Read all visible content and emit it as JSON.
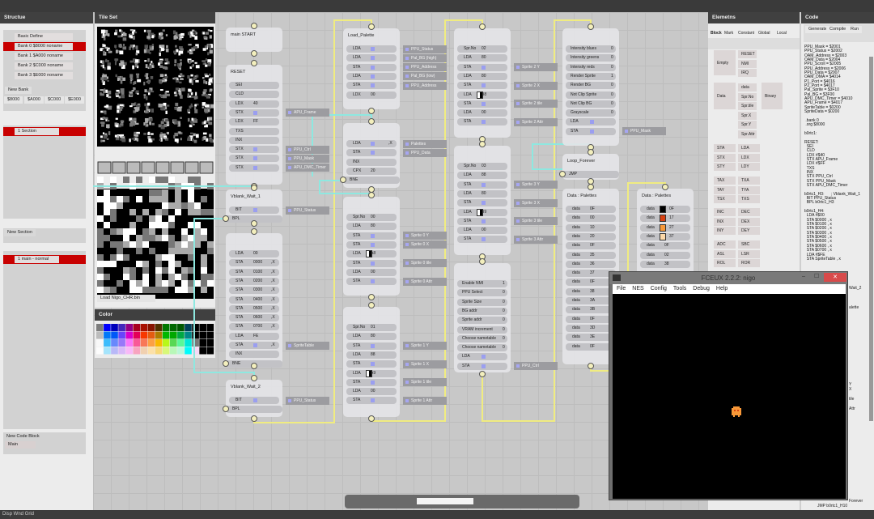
{
  "status_bar": "Disp Wnd Grid",
  "structure": {
    "title": "Structue",
    "banks": [
      "Basic Define",
      "Bank 0 $8000 noname",
      "Bank 1 $A000 noname",
      "Bank 2 $C000 noname",
      "Bank 3 $E000 noname"
    ],
    "selected_bank": 1,
    "new_bank": "New Bank",
    "bank_addrs": [
      "$8000",
      "$A000",
      "$C000",
      "$E000"
    ],
    "section": "1 Section",
    "new_section": "New Section",
    "block": "1 main - normal",
    "new_code_block": "New Code Block",
    "code_block_name": "Main"
  },
  "tileset": {
    "title": "Tile Set",
    "load_button": "Load Nigo_CHR.bin"
  },
  "color": {
    "title": "Color"
  },
  "elements": {
    "title": "Elemetns",
    "tabs": [
      "Block",
      "Mark",
      "Constant",
      "Global",
      "Local"
    ],
    "empty": "Empty",
    "vectors": [
      "RESET",
      "NMI",
      "IRQ"
    ],
    "data": "Data",
    "data_items": [
      "data",
      "Spr.No",
      "Spr.tile",
      "Spr.X",
      "Spr.Y",
      "Spr.Attr"
    ],
    "binary": "Binary",
    "ops": [
      [
        "STA",
        "LDA"
      ],
      [
        "STX",
        "LDX"
      ],
      [
        "STY",
        "LDY"
      ],
      [
        "TAX",
        "TXA"
      ],
      [
        "TAY",
        "TYA"
      ],
      [
        "TSX",
        "TXS"
      ],
      [
        "INC",
        "DEC"
      ],
      [
        "INX",
        "DEX"
      ],
      [
        "INY",
        "DEY"
      ],
      [
        "ADC",
        "SBC"
      ],
      [
        "ASL",
        "LSR"
      ],
      [
        "ROL",
        "ROR"
      ]
    ]
  },
  "code": {
    "title": "Code",
    "buttons": [
      "Generate",
      "Compile",
      "Run"
    ],
    "text": "PPU_Mask = $2001\nPPU_Status = $2002\nOAM_Address = $2003\nOAM_Data = $2004\nPPU_Scroll = $2005\nPPU_Address = $2006\nPPU_Data = $2007\nOAM_DMA = $4014\nP1_Port = $4016\nP2_Port = $4017\nPal_Sprite = $3F10\nPal_BG = $3F00\nAPU_DMC_Timer = $4010\nAPU_Frame = $4017\nSpriteTable = $0200\nSpriteData = $0200\n\n .bank 0\n .org $8000\n\nb0rtc1:\n\nRESET:\n  SEI\n  CLD\n  LDX #$40\n  STX APU_Frame\n  LDX #$FF\n  TXS\n  INX\n  STX PPU_Ctrl\n  STX PPU_Mask\n  STX APU_DMC_Timer\n\nb0rtc1_H3:      ; Vblank_Wait_1\n  BIT PPU_Status\n  BPL b0rtc1_H3\n\nb0rtc1_H4:\n  LDA #$00\n  STA $0000 , x\n  STA $0100 , x\n  STA $0200 , x\n  STA $0300 , x\n  STA $0400 , x\n  STA $0500 , x\n  STA $0600 , x\n  STA $0700 , x\n  LDA #$FE\n  STA SpriteTable , x",
    "fragments": [
      "Wait_2",
      "alette",
      "Y",
      "X",
      "tile",
      "Attr",
      "Forever",
      "JMP b0rtc1_H10"
    ]
  },
  "nodes": [
    {
      "title": "main START",
      "rows": []
    },
    {
      "title": "RESET",
      "rows": [
        {
          "op": "SEI"
        },
        {
          "op": "CLD"
        },
        {
          "op": "LDX",
          "val": "40"
        },
        {
          "op": "STX",
          "ref": "APU_Frame"
        },
        {
          "op": "LDX",
          "val": "FF"
        },
        {
          "op": "TXS"
        },
        {
          "op": "INX"
        },
        {
          "op": "STX",
          "ref": "PPU_Ctrl"
        },
        {
          "op": "STX",
          "ref": "PPU_Mask"
        },
        {
          "op": "STX",
          "ref": "APU_DMC_Timer"
        }
      ]
    },
    {
      "title": "Vblank_Wait_1",
      "rows": [
        {
          "op": "BIT",
          "ref": "PPU_Status"
        },
        {
          "op": "BPL",
          "branch": true
        }
      ]
    },
    {
      "title": "",
      "rows": [
        {
          "op": "LDA",
          "val": "00"
        },
        {
          "op": "STA",
          "val": "0000",
          "x": ",X"
        },
        {
          "op": "STA",
          "val": "0100",
          "x": ",X"
        },
        {
          "op": "STA",
          "val": "0200",
          "x": ",X"
        },
        {
          "op": "STA",
          "val": "0300",
          "x": ",X"
        },
        {
          "op": "STA",
          "val": "0400",
          "x": ",X"
        },
        {
          "op": "STA",
          "val": "0500",
          "x": ",X"
        },
        {
          "op": "STA",
          "val": "0600",
          "x": ",X"
        },
        {
          "op": "STA",
          "val": "0700",
          "x": ",X"
        },
        {
          "op": "LDA",
          "val": "FE"
        },
        {
          "op": "STA",
          "ref": "SpriteTable",
          "x": ",X"
        },
        {
          "op": "INX"
        },
        {
          "op": "BNE",
          "branch": true
        }
      ]
    },
    {
      "title": "Vblank_Wait_2",
      "rows": [
        {
          "op": "BIT",
          "ref": "PPU_Status"
        },
        {
          "op": "BPL",
          "branch": true
        }
      ]
    },
    {
      "title": "Load_Palette",
      "rows": [
        {
          "op": "LDA",
          "ref": "PPU_Status"
        },
        {
          "op": "LDA",
          "ref": "Pal_BG (high)"
        },
        {
          "op": "STA",
          "ref": "PPU_Address"
        },
        {
          "op": "LDA",
          "ref": "Pal_BG (low)"
        },
        {
          "op": "STA",
          "ref": "PPU_Address"
        },
        {
          "op": "LDX",
          "val": "00"
        }
      ]
    },
    {
      "title": "",
      "rows": [
        {
          "op": "LDA",
          "x": ",X",
          "ref": "Palettes"
        },
        {
          "op": "STA",
          "ref": "PPU_Data"
        },
        {
          "op": "INX"
        },
        {
          "op": "CPX",
          "val": "20"
        },
        {
          "op": "BNE",
          "branch": true
        }
      ]
    },
    {
      "title": "",
      "rows": [
        {
          "op": "Spr.No",
          "val": "00"
        },
        {
          "op": "LDA",
          "val": "80"
        },
        {
          "op": "STA",
          "ref": "Sprite 0 Y"
        },
        {
          "op": "STA",
          "ref": "Sprite 0 X"
        },
        {
          "op": "LDA",
          "val": "A8",
          "tile": true
        },
        {
          "op": "STA",
          "ref": "Sprite 0 tile"
        },
        {
          "op": "LDA",
          "val": "00"
        },
        {
          "op": "STA",
          "ref": "Sprite 0 Attr"
        }
      ]
    },
    {
      "title": "",
      "rows": [
        {
          "op": "Spr.No",
          "val": "01"
        },
        {
          "op": "LDA",
          "val": "80"
        },
        {
          "op": "STA",
          "ref": "Sprite 1 Y"
        },
        {
          "op": "LDA",
          "val": "88"
        },
        {
          "op": "STA",
          "ref": "Sprite 1 X"
        },
        {
          "op": "LDA",
          "val": "A9",
          "tile": true
        },
        {
          "op": "STA",
          "ref": "Sprite 1 tile"
        },
        {
          "op": "LDA",
          "val": "00"
        },
        {
          "op": "STA",
          "ref": "Sprite 1 Attr"
        }
      ]
    },
    {
      "title": "",
      "rows": [
        {
          "op": "Spr.No",
          "val": "02"
        },
        {
          "op": "LDA",
          "val": "80"
        },
        {
          "op": "STA",
          "ref": "Sprite 2 Y"
        },
        {
          "op": "LDA",
          "val": "80"
        },
        {
          "op": "STA",
          "ref": "Sprite 2 X"
        },
        {
          "op": "LDA",
          "val": "B8",
          "tile": true
        },
        {
          "op": "STA",
          "ref": "Sprite 2 tile"
        },
        {
          "op": "LDA",
          "val": "00"
        },
        {
          "op": "STA",
          "ref": "Sprite 2 Attr"
        }
      ]
    },
    {
      "title": "",
      "rows": [
        {
          "op": "Spr.No",
          "val": "03"
        },
        {
          "op": "LDA",
          "val": "88"
        },
        {
          "op": "STA",
          "ref": "Sprite 3 Y"
        },
        {
          "op": "LDA",
          "val": "80"
        },
        {
          "op": "STA",
          "ref": "Sprite 3 X"
        },
        {
          "op": "LDA",
          "val": "B9",
          "tile": true
        },
        {
          "op": "STA",
          "ref": "Sprite 3 tile"
        },
        {
          "op": "LDA",
          "val": "00"
        },
        {
          "op": "STA",
          "ref": "Sprite 3 Attr"
        }
      ]
    },
    {
      "title": "",
      "wide": true,
      "rows": [
        {
          "op": "Enable NMI",
          "val": "1"
        },
        {
          "op": "PPU Select",
          "val": "0"
        },
        {
          "op": "Sprite Size",
          "val": "0"
        },
        {
          "op": "BG addr",
          "val": "0"
        },
        {
          "op": "Sprite addr",
          "val": "0"
        },
        {
          "op": "VRAM increment",
          "val": "0"
        },
        {
          "op": "Choose nametable",
          "val": "0"
        },
        {
          "op": "Choose nametable",
          "val": "0"
        },
        {
          "op": "LDA"
        },
        {
          "op": "STA",
          "ref": "PPU_Ctrl"
        }
      ]
    },
    {
      "title": "",
      "wide": true,
      "rows": [
        {
          "op": "Intensity blues",
          "val": "0"
        },
        {
          "op": "Intensity greens",
          "val": "0"
        },
        {
          "op": "Intensity reds",
          "val": "0"
        },
        {
          "op": "Render Sprite",
          "val": "1"
        },
        {
          "op": "Render BG",
          "val": "0"
        },
        {
          "op": "Not Clip Sprite",
          "val": "0"
        },
        {
          "op": "Not Clip BG",
          "val": "0"
        },
        {
          "op": "Grayscale",
          "val": "0"
        },
        {
          "op": "LDA"
        },
        {
          "op": "STA",
          "ref": "PPU_Mask"
        }
      ]
    },
    {
      "title": "Loop_Forever",
      "rows": [
        {
          "op": "JMP",
          "branch": true
        }
      ]
    },
    {
      "title": "Data : Palettes",
      "rows": [
        {
          "op": "data",
          "val": "0F"
        },
        {
          "op": "data",
          "val": "00"
        },
        {
          "op": "data",
          "val": "10"
        },
        {
          "op": "data",
          "val": "20"
        },
        {
          "op": "data",
          "val": "0F"
        },
        {
          "op": "data",
          "val": "35"
        },
        {
          "op": "data",
          "val": "36"
        },
        {
          "op": "data",
          "val": "37"
        },
        {
          "op": "data",
          "val": "0F"
        },
        {
          "op": "data",
          "val": "38"
        },
        {
          "op": "data",
          "val": "3A"
        },
        {
          "op": "data",
          "val": "3B"
        },
        {
          "op": "data",
          "val": "0F"
        },
        {
          "op": "data",
          "val": "3D"
        },
        {
          "op": "data",
          "val": "3E"
        },
        {
          "op": "data",
          "val": "0F"
        }
      ]
    },
    {
      "title": "Data : Palettes",
      "rows": [
        {
          "op": "data",
          "val": "0F",
          "color": "#000000"
        },
        {
          "op": "data",
          "val": "17",
          "color": "#d84010"
        },
        {
          "op": "data",
          "val": "27",
          "color": "#f89838"
        },
        {
          "op": "data",
          "val": "37",
          "color": "#fcd8a8"
        },
        {
          "op": "data",
          "val": "0F"
        },
        {
          "op": "data",
          "val": "02"
        },
        {
          "op": "data",
          "val": "38"
        }
      ]
    }
  ],
  "fceux": {
    "title": "FCEUX 2.2.2: nigo",
    "menu": [
      "File",
      "NES",
      "Config",
      "Tools",
      "Debug",
      "Help"
    ],
    "close": "✕",
    "minimize": "–",
    "maximize": "☐"
  },
  "colors": {
    "wire": "#f0ec80",
    "link": "#8ee8e0",
    "accent_red": "#c80000",
    "sprite": "#f89838"
  }
}
